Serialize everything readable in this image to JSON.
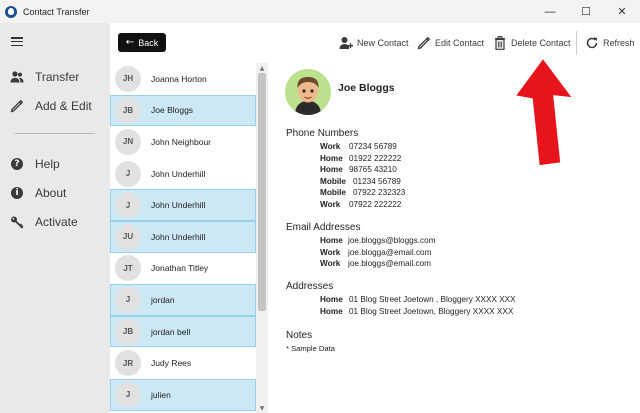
{
  "window": {
    "title": "Contact Transfer",
    "controls": {
      "minimize": "—",
      "maximize": "☐",
      "close": "✕"
    }
  },
  "sidebar": {
    "items": [
      {
        "label": "Transfer",
        "icon": "users-icon"
      },
      {
        "label": "Add & Edit",
        "icon": "pencil-icon"
      },
      {
        "label": "Help",
        "icon": "question-icon"
      },
      {
        "label": "About",
        "icon": "info-icon"
      },
      {
        "label": "Activate",
        "icon": "key-icon"
      }
    ]
  },
  "toolbar": {
    "back_label": "Back",
    "new_contact_label": "New Contact",
    "edit_contact_label": "Edit Contact",
    "delete_contact_label": "Delete Contact",
    "refresh_label": "Refresh"
  },
  "contacts": [
    {
      "initials": "JH",
      "name": "Joanna Horton",
      "selected": false
    },
    {
      "initials": "JB",
      "name": "Joe Bloggs",
      "selected": true
    },
    {
      "initials": "JN",
      "name": "John Neighbour",
      "selected": false
    },
    {
      "initials": "J",
      "name": "John Underhill",
      "selected": false
    },
    {
      "initials": "J",
      "name": "John Underhill",
      "selected": true
    },
    {
      "initials": "JU",
      "name": "John Underhill",
      "selected": true
    },
    {
      "initials": "JT",
      "name": "Jonathan Titley",
      "selected": false
    },
    {
      "initials": "J",
      "name": "jordan",
      "selected": true
    },
    {
      "initials": "JB",
      "name": "jordan bell",
      "selected": true
    },
    {
      "initials": "JR",
      "name": "Judy Rees",
      "selected": false
    },
    {
      "initials": "J",
      "name": "julien",
      "selected": true
    }
  ],
  "detail": {
    "name": "Joe Bloggs",
    "phone_title": "Phone Numbers",
    "phones": [
      {
        "type": "Work",
        "value": "07234 56789"
      },
      {
        "type": "Home",
        "value": "01922 222222"
      },
      {
        "type": "Home",
        "value": "98765 43210"
      },
      {
        "type": "Mobile",
        "value": "01234 56789"
      },
      {
        "type": "Mobile",
        "value": "07922 232323"
      },
      {
        "type": "Work",
        "value": "07922 222222"
      }
    ],
    "email_title": "Email Addresses",
    "emails": [
      {
        "type": "Home",
        "value": "joe.bloggs@bloggs.com"
      },
      {
        "type": "Work",
        "value": "joe.blogga@email.com"
      },
      {
        "type": "Work",
        "value": "joe.bloggs@email.com"
      }
    ],
    "address_title": "Addresses",
    "addresses": [
      {
        "type": "Home",
        "value": "01 Blog Street Joetown , Bloggery XXXX XXX"
      },
      {
        "type": "Home",
        "value": "01 Blog Street Joetown, Bloggery XXXX XXX"
      }
    ],
    "notes_title": "Notes",
    "notes": "* Sample Data"
  },
  "colors": {
    "selected_row": "#cce8f4",
    "selected_border": "#99d1ea",
    "sidebar_bg": "#e9e9e9",
    "arrow": "#e8141c",
    "avatar_bg": "#bce08e"
  }
}
